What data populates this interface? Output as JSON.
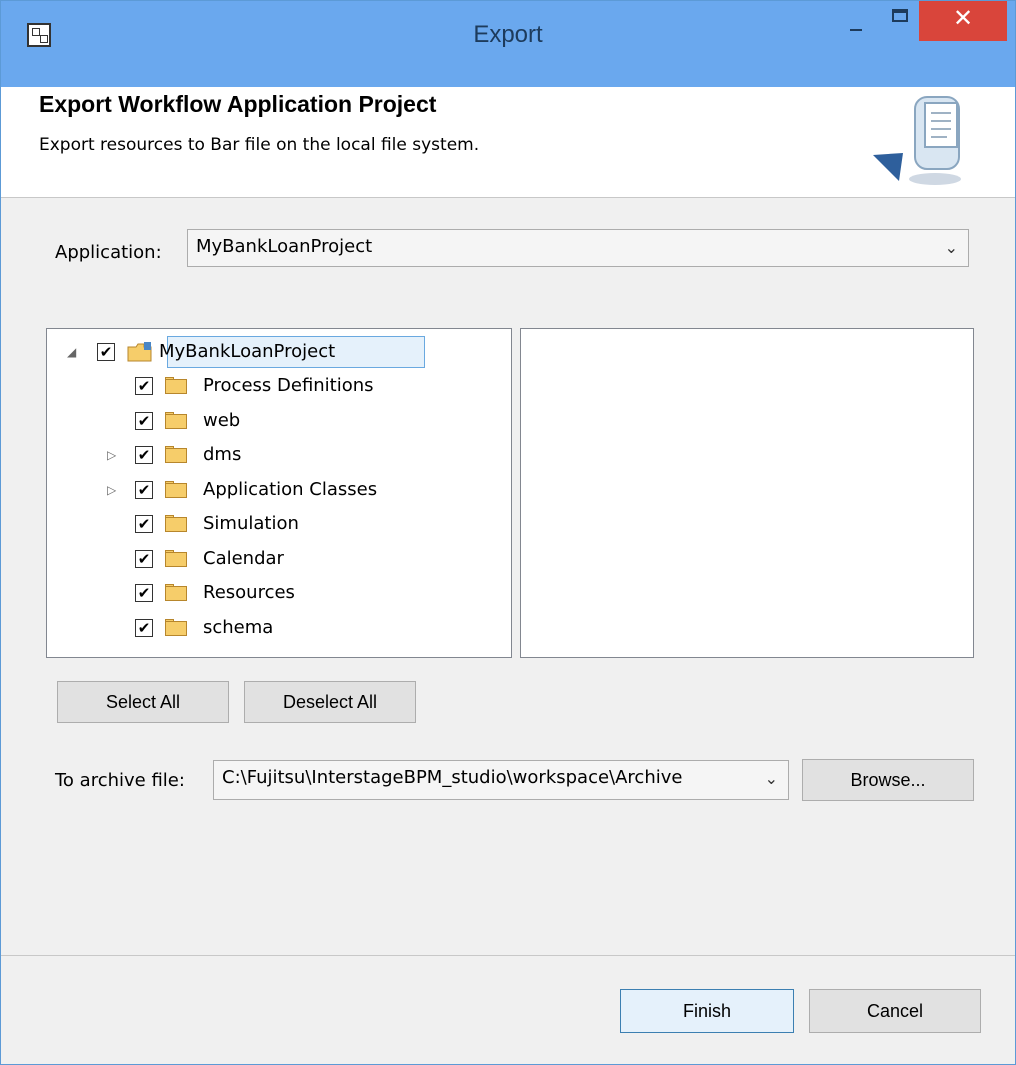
{
  "window": {
    "title": "Export"
  },
  "header": {
    "title": "Export Workflow Application Project",
    "description": "Export resources to Bar file on the local file system."
  },
  "application": {
    "label": "Application:",
    "value": "MyBankLoanProject"
  },
  "tree": {
    "root": {
      "label": "MyBankLoanProject",
      "checked": true,
      "expanded": true
    },
    "items": [
      {
        "label": "Process Definitions",
        "checked": true,
        "expandable": false
      },
      {
        "label": "web",
        "checked": true,
        "expandable": false
      },
      {
        "label": "dms",
        "checked": true,
        "expandable": true
      },
      {
        "label": "Application Classes",
        "checked": true,
        "expandable": true
      },
      {
        "label": "Simulation",
        "checked": true,
        "expandable": false
      },
      {
        "label": "Calendar",
        "checked": true,
        "expandable": false
      },
      {
        "label": "Resources",
        "checked": true,
        "expandable": false
      },
      {
        "label": "schema",
        "checked": true,
        "expandable": false
      }
    ]
  },
  "buttons": {
    "select_all": "Select All",
    "deselect_all": "Deselect All",
    "browse": "Browse...",
    "finish": "Finish",
    "cancel": "Cancel"
  },
  "archive": {
    "label": "To archive file:",
    "value": "C:\\Fujitsu\\InterstageBPM_studio\\workspace\\Archive"
  },
  "colors": {
    "titlebar": "#6aa8ee",
    "close_button": "#d9453b",
    "selection": "#e5f1fb",
    "default_button_border": "#3c7fb1"
  },
  "icons": {
    "app": "window-app-icon",
    "minimize": "minimize-icon",
    "maximize": "maximize-icon",
    "close": "close-icon",
    "wizard": "export-wizard-icon",
    "folder": "folder-icon",
    "project": "project-folder-icon"
  }
}
